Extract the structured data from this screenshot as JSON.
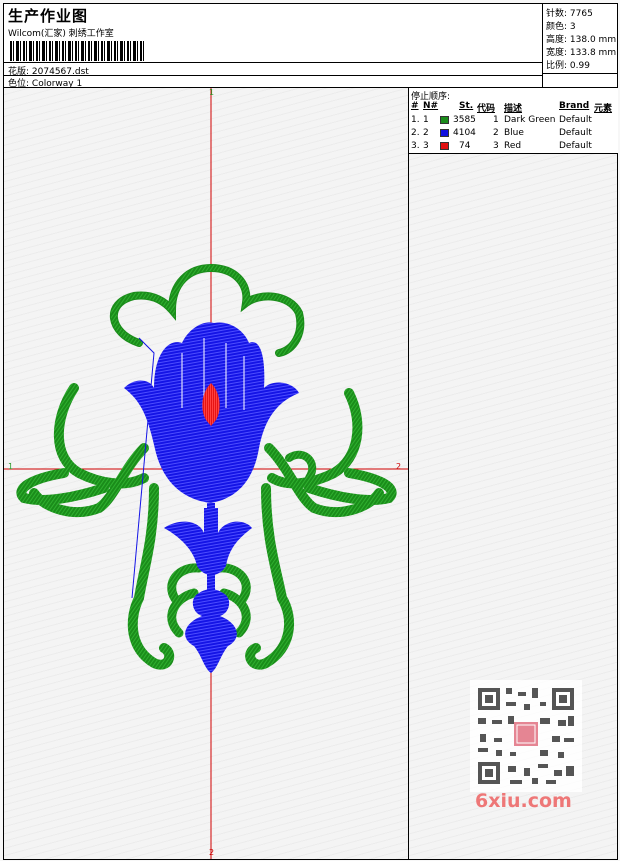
{
  "header": {
    "title": "生产作业图",
    "studio": "Wilcom(汇家) 刺绣工作室",
    "file_label": "花版:",
    "file_name": "2074567.dst",
    "colorway_label": "色位:",
    "colorway": "Colorway 1"
  },
  "stats": [
    {
      "label": "针数:",
      "value": "7765"
    },
    {
      "label": "颜色:",
      "value": "3"
    },
    {
      "label": "高度:",
      "value": "138.0 mm"
    },
    {
      "label": "宽度:",
      "value": "133.8 mm"
    },
    {
      "label": "比例:",
      "value": "0.99"
    }
  ],
  "stop_table": {
    "title": "停止顺序:",
    "headers": [
      "#",
      "N#",
      "St.",
      "代码",
      "描述",
      "Brand",
      "元素"
    ],
    "rows": [
      {
        "index": "1.",
        "n": "1",
        "stitches": "3585",
        "code": "1",
        "desc": "Dark Green",
        "brand": "Default",
        "color": "#1a8c1a"
      },
      {
        "index": "2.",
        "n": "2",
        "stitches": "4104",
        "code": "2",
        "desc": "Blue",
        "brand": "Default",
        "color": "#1010e0"
      },
      {
        "index": "3.",
        "n": "3",
        "stitches": "74",
        "code": "3",
        "desc": "Red",
        "brand": "Default",
        "color": "#e01010"
      }
    ]
  },
  "axes": {
    "top": "1",
    "bottom": "2",
    "left": "1",
    "right": "2"
  },
  "watermark": {
    "text": "6xiu.com"
  },
  "colors": {
    "green": "#1a8c1a",
    "blue": "#1414e6",
    "red": "#e61414",
    "axis": "#d00000"
  }
}
